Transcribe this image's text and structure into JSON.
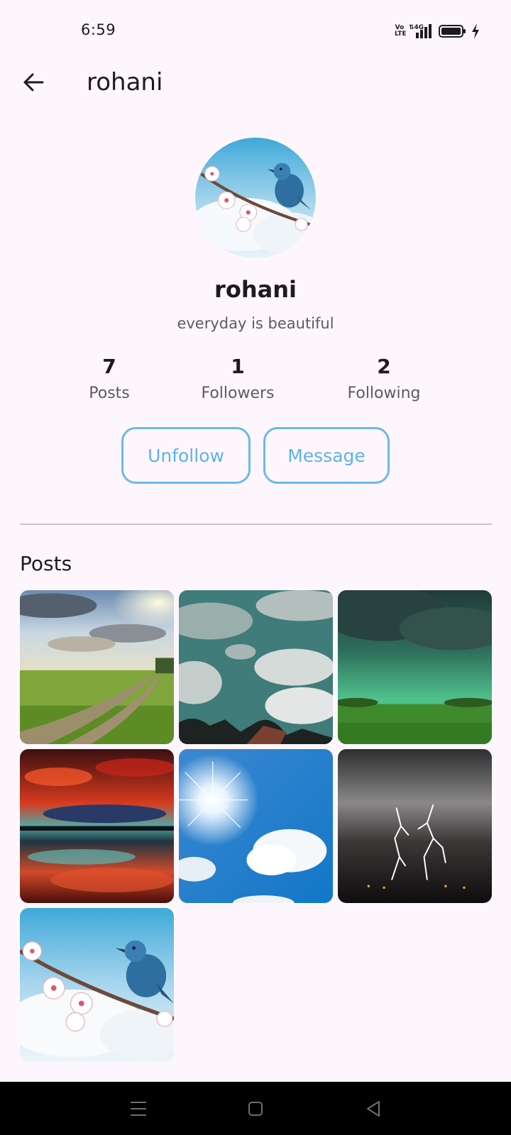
{
  "status_bar": {
    "time": "6:59",
    "network": "4G",
    "volte_label": "Vo LTE"
  },
  "app_bar": {
    "title": "rohani",
    "back_icon": "arrow-left-icon"
  },
  "profile": {
    "name": "rohani",
    "bio": "everyday is beautiful",
    "stats": [
      {
        "count": "7",
        "label": "Posts"
      },
      {
        "count": "1",
        "label": "Followers"
      },
      {
        "count": "2",
        "label": "Following"
      }
    ],
    "unfollow_label": "Unfollow",
    "message_label": "Message"
  },
  "posts_section": {
    "title": "Posts",
    "posts": [
      {
        "scene": "green-meadow-path"
      },
      {
        "scene": "teal-cloudy-sky"
      },
      {
        "scene": "green-storm-field"
      },
      {
        "scene": "red-sunset-reflection"
      },
      {
        "scene": "blue-sky-sun"
      },
      {
        "scene": "lightning-night"
      },
      {
        "scene": "bluebird-blossom"
      }
    ]
  },
  "colors": {
    "background": "#fdf7fd",
    "accent": "#5fb1ee",
    "divider": "#cac4cf",
    "nav_bar": "#000000"
  }
}
